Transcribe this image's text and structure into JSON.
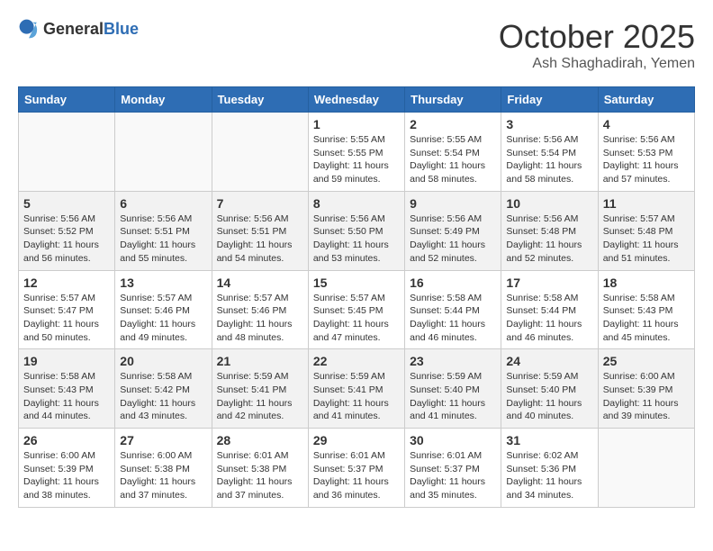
{
  "header": {
    "logo_general": "General",
    "logo_blue": "Blue",
    "month": "October 2025",
    "location": "Ash Shaghadirah, Yemen"
  },
  "weekdays": [
    "Sunday",
    "Monday",
    "Tuesday",
    "Wednesday",
    "Thursday",
    "Friday",
    "Saturday"
  ],
  "weeks": [
    [
      {
        "day": "",
        "info": ""
      },
      {
        "day": "",
        "info": ""
      },
      {
        "day": "",
        "info": ""
      },
      {
        "day": "1",
        "info": "Sunrise: 5:55 AM\nSunset: 5:55 PM\nDaylight: 11 hours\nand 59 minutes."
      },
      {
        "day": "2",
        "info": "Sunrise: 5:55 AM\nSunset: 5:54 PM\nDaylight: 11 hours\nand 58 minutes."
      },
      {
        "day": "3",
        "info": "Sunrise: 5:56 AM\nSunset: 5:54 PM\nDaylight: 11 hours\nand 58 minutes."
      },
      {
        "day": "4",
        "info": "Sunrise: 5:56 AM\nSunset: 5:53 PM\nDaylight: 11 hours\nand 57 minutes."
      }
    ],
    [
      {
        "day": "5",
        "info": "Sunrise: 5:56 AM\nSunset: 5:52 PM\nDaylight: 11 hours\nand 56 minutes."
      },
      {
        "day": "6",
        "info": "Sunrise: 5:56 AM\nSunset: 5:51 PM\nDaylight: 11 hours\nand 55 minutes."
      },
      {
        "day": "7",
        "info": "Sunrise: 5:56 AM\nSunset: 5:51 PM\nDaylight: 11 hours\nand 54 minutes."
      },
      {
        "day": "8",
        "info": "Sunrise: 5:56 AM\nSunset: 5:50 PM\nDaylight: 11 hours\nand 53 minutes."
      },
      {
        "day": "9",
        "info": "Sunrise: 5:56 AM\nSunset: 5:49 PM\nDaylight: 11 hours\nand 52 minutes."
      },
      {
        "day": "10",
        "info": "Sunrise: 5:56 AM\nSunset: 5:48 PM\nDaylight: 11 hours\nand 52 minutes."
      },
      {
        "day": "11",
        "info": "Sunrise: 5:57 AM\nSunset: 5:48 PM\nDaylight: 11 hours\nand 51 minutes."
      }
    ],
    [
      {
        "day": "12",
        "info": "Sunrise: 5:57 AM\nSunset: 5:47 PM\nDaylight: 11 hours\nand 50 minutes."
      },
      {
        "day": "13",
        "info": "Sunrise: 5:57 AM\nSunset: 5:46 PM\nDaylight: 11 hours\nand 49 minutes."
      },
      {
        "day": "14",
        "info": "Sunrise: 5:57 AM\nSunset: 5:46 PM\nDaylight: 11 hours\nand 48 minutes."
      },
      {
        "day": "15",
        "info": "Sunrise: 5:57 AM\nSunset: 5:45 PM\nDaylight: 11 hours\nand 47 minutes."
      },
      {
        "day": "16",
        "info": "Sunrise: 5:58 AM\nSunset: 5:44 PM\nDaylight: 11 hours\nand 46 minutes."
      },
      {
        "day": "17",
        "info": "Sunrise: 5:58 AM\nSunset: 5:44 PM\nDaylight: 11 hours\nand 46 minutes."
      },
      {
        "day": "18",
        "info": "Sunrise: 5:58 AM\nSunset: 5:43 PM\nDaylight: 11 hours\nand 45 minutes."
      }
    ],
    [
      {
        "day": "19",
        "info": "Sunrise: 5:58 AM\nSunset: 5:43 PM\nDaylight: 11 hours\nand 44 minutes."
      },
      {
        "day": "20",
        "info": "Sunrise: 5:58 AM\nSunset: 5:42 PM\nDaylight: 11 hours\nand 43 minutes."
      },
      {
        "day": "21",
        "info": "Sunrise: 5:59 AM\nSunset: 5:41 PM\nDaylight: 11 hours\nand 42 minutes."
      },
      {
        "day": "22",
        "info": "Sunrise: 5:59 AM\nSunset: 5:41 PM\nDaylight: 11 hours\nand 41 minutes."
      },
      {
        "day": "23",
        "info": "Sunrise: 5:59 AM\nSunset: 5:40 PM\nDaylight: 11 hours\nand 41 minutes."
      },
      {
        "day": "24",
        "info": "Sunrise: 5:59 AM\nSunset: 5:40 PM\nDaylight: 11 hours\nand 40 minutes."
      },
      {
        "day": "25",
        "info": "Sunrise: 6:00 AM\nSunset: 5:39 PM\nDaylight: 11 hours\nand 39 minutes."
      }
    ],
    [
      {
        "day": "26",
        "info": "Sunrise: 6:00 AM\nSunset: 5:39 PM\nDaylight: 11 hours\nand 38 minutes."
      },
      {
        "day": "27",
        "info": "Sunrise: 6:00 AM\nSunset: 5:38 PM\nDaylight: 11 hours\nand 37 minutes."
      },
      {
        "day": "28",
        "info": "Sunrise: 6:01 AM\nSunset: 5:38 PM\nDaylight: 11 hours\nand 37 minutes."
      },
      {
        "day": "29",
        "info": "Sunrise: 6:01 AM\nSunset: 5:37 PM\nDaylight: 11 hours\nand 36 minutes."
      },
      {
        "day": "30",
        "info": "Sunrise: 6:01 AM\nSunset: 5:37 PM\nDaylight: 11 hours\nand 35 minutes."
      },
      {
        "day": "31",
        "info": "Sunrise: 6:02 AM\nSunset: 5:36 PM\nDaylight: 11 hours\nand 34 minutes."
      },
      {
        "day": "",
        "info": ""
      }
    ]
  ]
}
